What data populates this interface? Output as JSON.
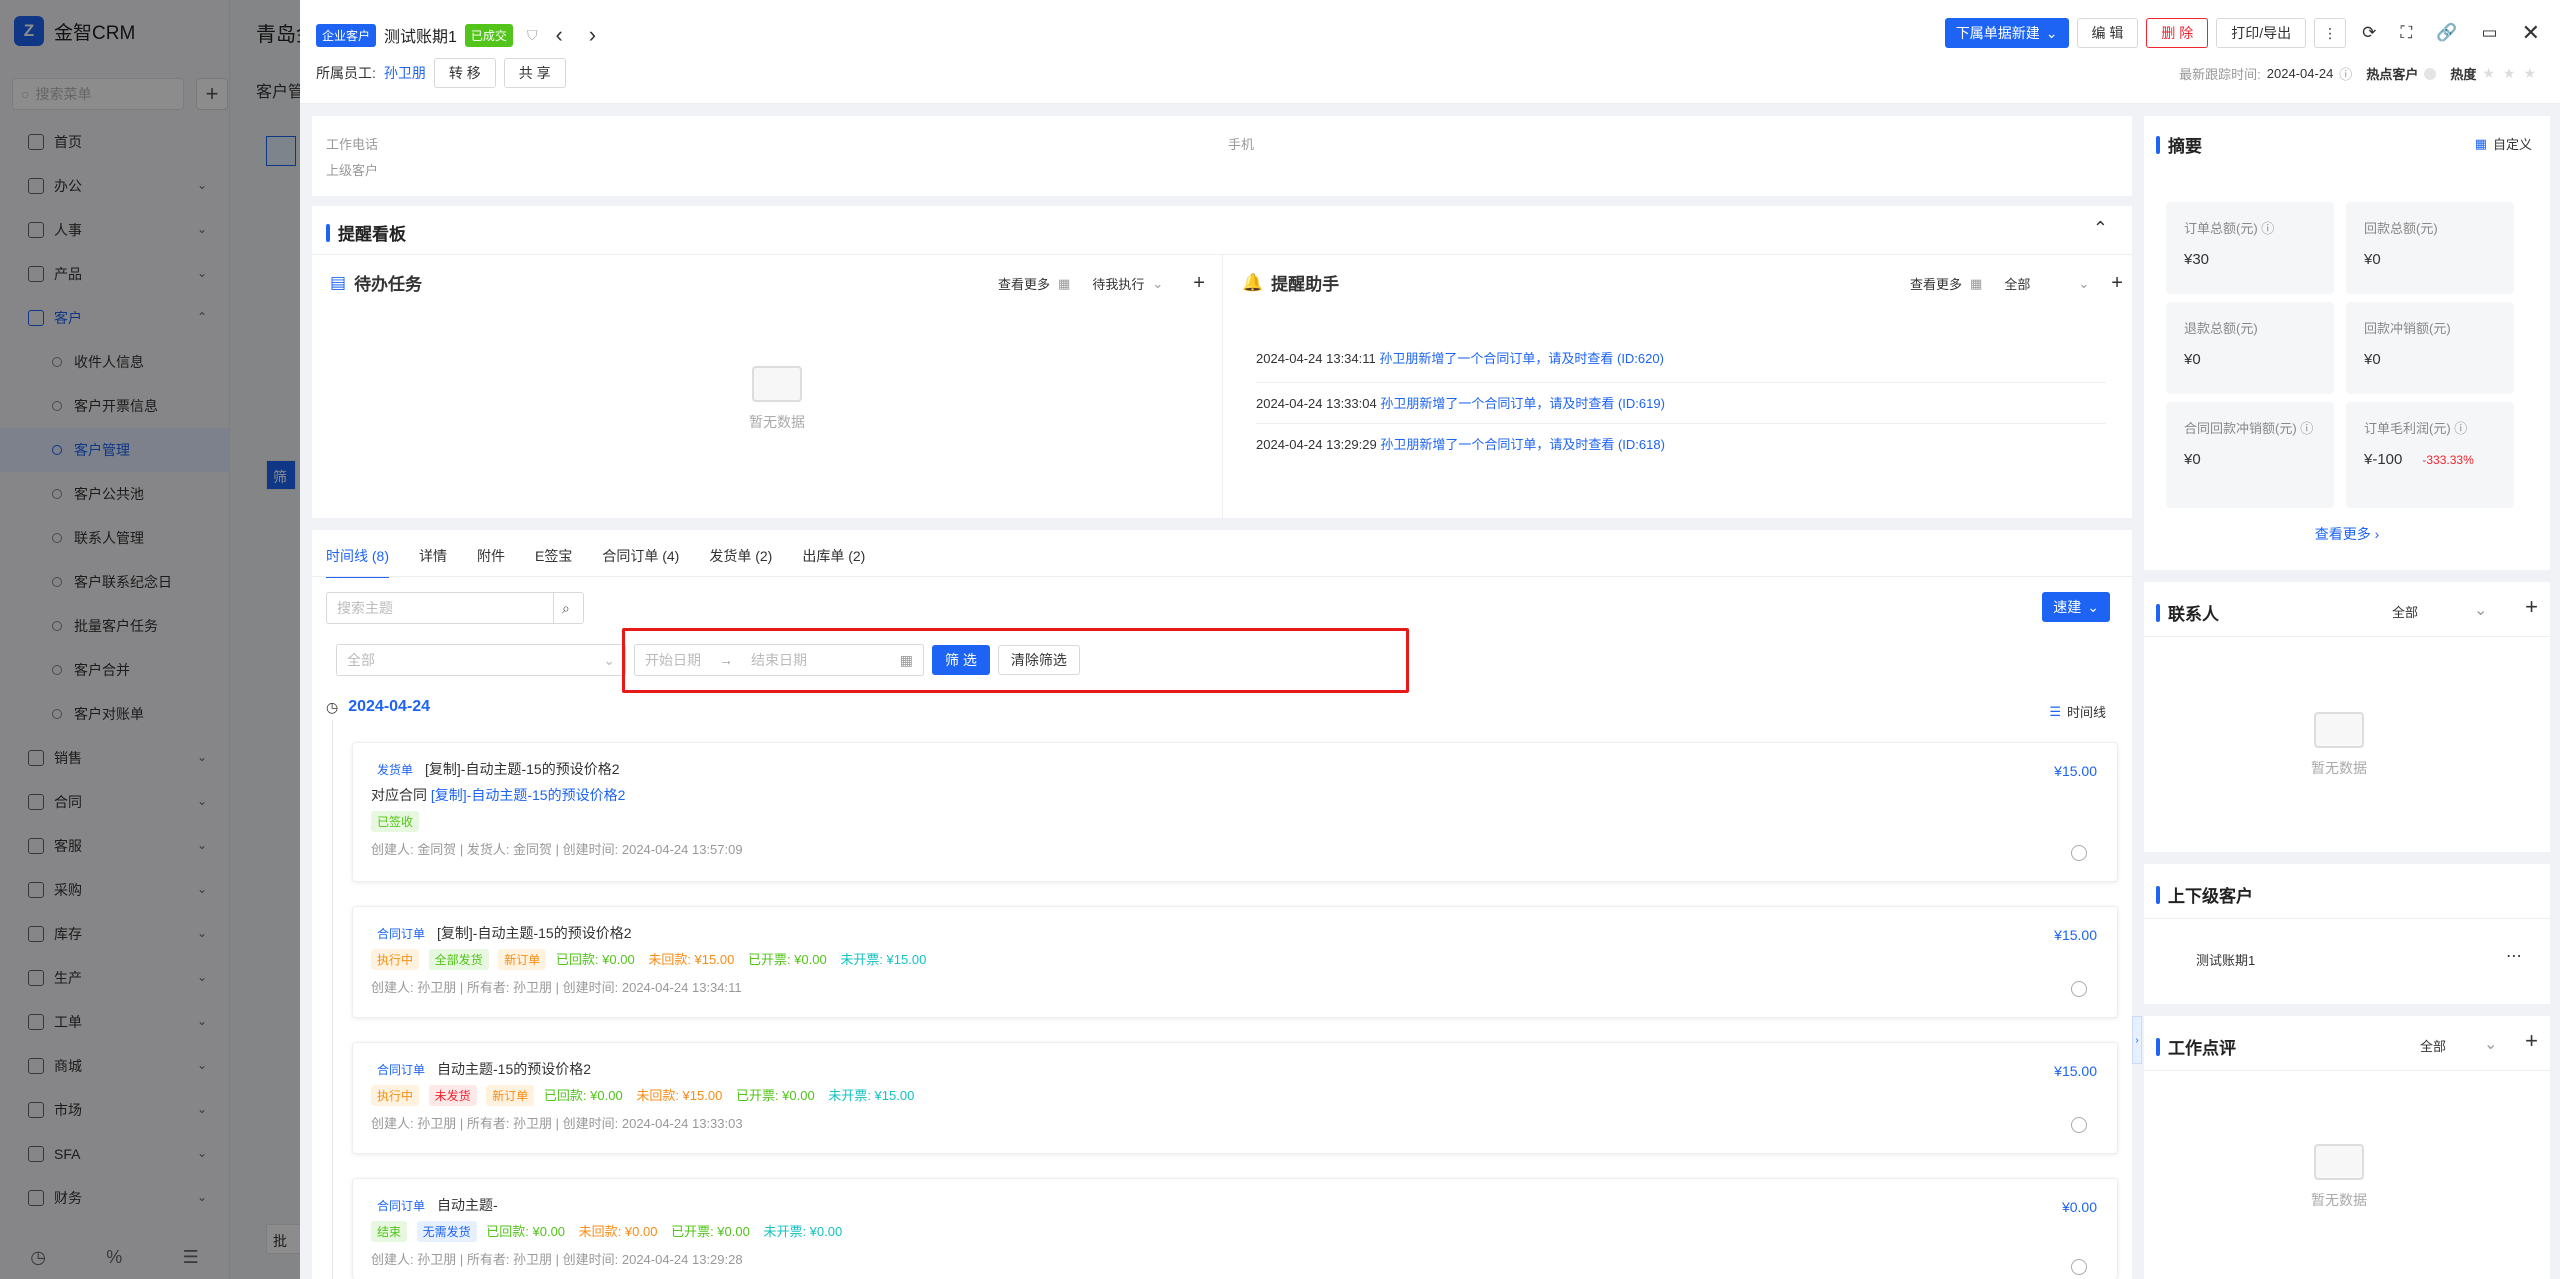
{
  "app": {
    "name": "金智CRM",
    "search_placeholder": "搜索菜单"
  },
  "sidebar": {
    "items": [
      {
        "label": "首页",
        "icon": "home-icon"
      },
      {
        "label": "办公",
        "icon": "office-icon",
        "chev": "⌄"
      },
      {
        "label": "人事",
        "icon": "people-icon",
        "chev": "⌄"
      },
      {
        "label": "产品",
        "icon": "product-icon",
        "chev": "⌄"
      },
      {
        "label": "客户",
        "icon": "customer-icon",
        "chev": "⌃"
      }
    ],
    "sub_items": [
      "收件人信息",
      "客户开票信息",
      "客户管理",
      "客户公共池",
      "联系人管理",
      "客户联系纪念日",
      "批量客户任务",
      "客户合并",
      "客户对账单"
    ],
    "items2": [
      {
        "label": "销售",
        "icon": "sales-icon"
      },
      {
        "label": "合同",
        "icon": "contract-icon"
      },
      {
        "label": "客服",
        "icon": "service-icon"
      },
      {
        "label": "采购",
        "icon": "purchase-icon"
      },
      {
        "label": "库存",
        "icon": "stock-icon"
      },
      {
        "label": "生产",
        "icon": "production-icon"
      },
      {
        "label": "工单",
        "icon": "workorder-icon"
      },
      {
        "label": "商城",
        "icon": "mall-icon"
      },
      {
        "label": "市场",
        "icon": "market-icon"
      },
      {
        "label": "SFA",
        "icon": "sfa-icon"
      },
      {
        "label": "财务",
        "icon": "finance-icon"
      }
    ]
  },
  "background": {
    "title": "青岛金",
    "sub": "客户管",
    "btn": "筛",
    "batch": "批"
  },
  "header": {
    "tag_type": "企业客户",
    "name": "测试账期1",
    "tag_status": "已成交",
    "owner_label": "所属员工:",
    "owner": "孙卫朋",
    "transfer": "转 移",
    "share": "共 享",
    "new_sub": "下属单据新建",
    "edit": "编 辑",
    "delete": "删 除",
    "print": "打印/导出",
    "last_follow_label": "最新跟踪时间:",
    "last_follow": "2024-04-24",
    "hot_label": "热点客户",
    "heat_label": "热度"
  },
  "info": {
    "work_phone": "工作电话",
    "mobile": "手机",
    "parent": "上级客户"
  },
  "remind": {
    "title": "提醒看板",
    "todo_title": "待办任务",
    "todo_more": "查看更多",
    "todo_filter": "待我执行",
    "empty": "暂无数据",
    "assistant_title": "提醒助手",
    "assistant_more": "查看更多",
    "assistant_filter": "全部",
    "notices": [
      {
        "time": "2024-04-24 13:34:11",
        "text": "孙卫朋新增了一个合同订单，请及时查看 (ID:620)"
      },
      {
        "time": "2024-04-24 13:33:04",
        "text": "孙卫朋新增了一个合同订单，请及时查看 (ID:619)"
      },
      {
        "time": "2024-04-24 13:29:29",
        "text": "孙卫朋新增了一个合同订单，请及时查看 (ID:618)"
      }
    ]
  },
  "tabs": [
    "时间线 (8)",
    "详情",
    "附件",
    "E签宝",
    "合同订单 (4)",
    "发货单 (2)",
    "出库单 (2)"
  ],
  "timeline": {
    "search_placeholder": "搜索主题",
    "quick_new": "速建",
    "type_placeholder": "全部",
    "start_placeholder": "开始日期",
    "end_placeholder": "结束日期",
    "filter": "筛 选",
    "clear": "清除筛选",
    "date": "2024-04-24",
    "view": "时间线",
    "items": [
      {
        "type": "发货单",
        "title": "[复制]-自动主题-15的预设价格2",
        "line2_label": "对应合同",
        "line2_link": "[复制]-自动主题-15的预设价格2",
        "badge": "已签收",
        "meta": "创建人: 金同贺  |  发货人: 金同贺  |  创建时间: 2024-04-24 13:57:09",
        "amount": "¥15.00"
      },
      {
        "type": "合同订单",
        "title": "[复制]-自动主题-15的预设价格2",
        "badges": [
          "执行中",
          "全部发货",
          "新订单"
        ],
        "money": [
          "已回款: ¥0.00",
          "未回款: ¥15.00",
          "已开票: ¥0.00",
          "未开票: ¥15.00"
        ],
        "meta": "创建人: 孙卫朋  |  所有者: 孙卫朋  |  创建时间: 2024-04-24 13:34:11",
        "amount": "¥15.00"
      },
      {
        "type": "合同订单",
        "title": "自动主题-15的预设价格2",
        "badges": [
          "执行中",
          "未发货",
          "新订单"
        ],
        "money": [
          "已回款: ¥0.00",
          "未回款: ¥15.00",
          "已开票: ¥0.00",
          "未开票: ¥15.00"
        ],
        "meta": "创建人: 孙卫朋  |  所有者: 孙卫朋  |  创建时间: 2024-04-24 13:33:03",
        "amount": "¥15.00"
      },
      {
        "type": "合同订单",
        "title": "自动主题-",
        "badges": [
          "结束",
          "无需发货"
        ],
        "money": [
          "已回款: ¥0.00",
          "未回款: ¥0.00",
          "已开票: ¥0.00",
          "未开票: ¥0.00"
        ],
        "meta": "创建人: 孙卫朋  |  所有者: 孙卫朋  |  创建时间: 2024-04-24 13:29:28",
        "amount": "¥0.00"
      }
    ]
  },
  "summary": {
    "title": "摘要",
    "custom": "自定义",
    "stats": [
      {
        "label": "订单总额(元)",
        "value": "¥30"
      },
      {
        "label": "回款总额(元)",
        "value": "¥0"
      },
      {
        "label": "退款总额(元)",
        "value": "¥0"
      },
      {
        "label": "回款冲销额(元)",
        "value": "¥0"
      },
      {
        "label": "合同回款冲销额(元)",
        "value": "¥0"
      },
      {
        "label": "订单毛利润(元)",
        "value": "¥-100",
        "extra": "-333.33%"
      }
    ],
    "more": "查看更多"
  },
  "contacts": {
    "title": "联系人",
    "filter": "全部",
    "empty": "暂无数据"
  },
  "relations": {
    "title": "上下级客户",
    "item": "测试账期1"
  },
  "comments": {
    "title": "工作点评",
    "filter": "全部",
    "empty": "暂无数据"
  },
  "colors": {
    "accent": "#1d64f5",
    "danger": "#f5222d",
    "success": "#52c41a",
    "highlight": "#e81919"
  }
}
